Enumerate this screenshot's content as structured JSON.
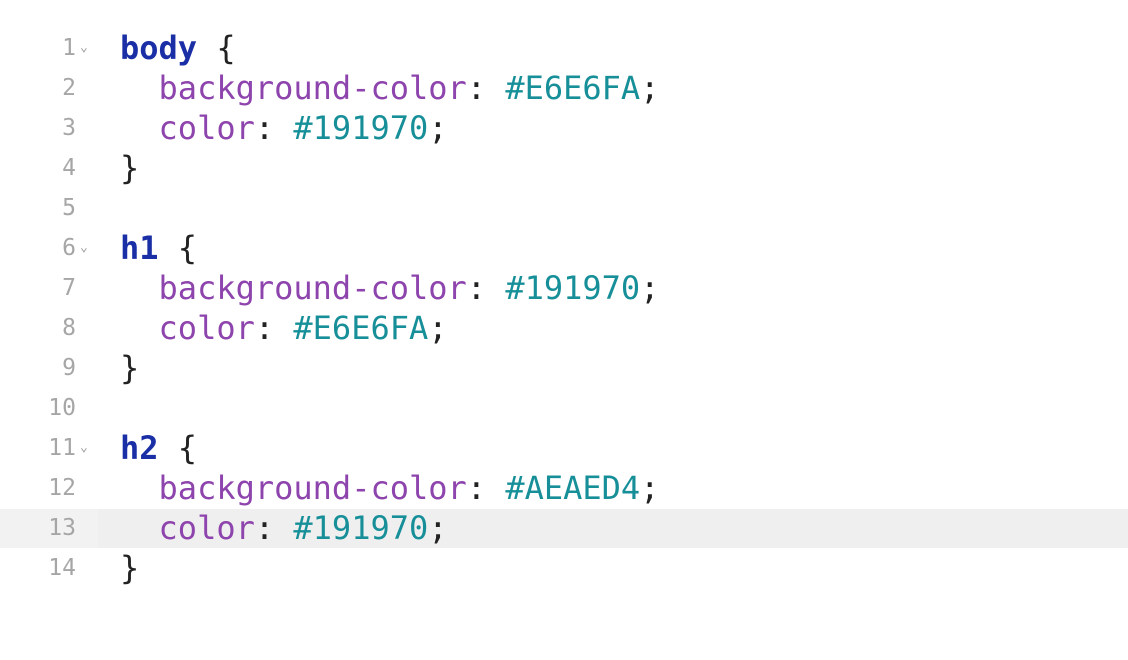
{
  "colors": {
    "selector": "#1a2fa6",
    "property": "#8e44ad",
    "value": "#178f99",
    "punctuation": "#222222",
    "line_number": "#a6a6a6",
    "active_line_bg": "#f2f2f2"
  },
  "editor": {
    "active_line": 13,
    "fold_icon": "chevron-down-icon",
    "fold_glyph": "⌄",
    "lines": [
      {
        "num": "1",
        "foldable": true,
        "selector": "body",
        "brace": " {"
      },
      {
        "num": "2",
        "indent": "  ",
        "property": "background-color",
        "colon": ": ",
        "value": "#E6E6FA",
        "semi": ";"
      },
      {
        "num": "3",
        "indent": "  ",
        "property": "color",
        "colon": ": ",
        "value": "#191970",
        "semi": ";"
      },
      {
        "num": "4",
        "close": "}"
      },
      {
        "num": "5"
      },
      {
        "num": "6",
        "foldable": true,
        "selector": "h1",
        "brace": " {"
      },
      {
        "num": "7",
        "indent": "  ",
        "property": "background-color",
        "colon": ": ",
        "value": "#191970",
        "semi": ";"
      },
      {
        "num": "8",
        "indent": "  ",
        "property": "color",
        "colon": ": ",
        "value": "#E6E6FA",
        "semi": ";"
      },
      {
        "num": "9",
        "close": "}"
      },
      {
        "num": "10"
      },
      {
        "num": "11",
        "foldable": true,
        "selector": "h2",
        "brace": " {"
      },
      {
        "num": "12",
        "indent": "  ",
        "property": "background-color",
        "colon": ": ",
        "value": "#AEAED4",
        "semi": ";"
      },
      {
        "num": "13",
        "indent": "  ",
        "property": "color",
        "colon": ": ",
        "value": "#191970",
        "semi": ";"
      },
      {
        "num": "14",
        "close": "}"
      }
    ]
  }
}
